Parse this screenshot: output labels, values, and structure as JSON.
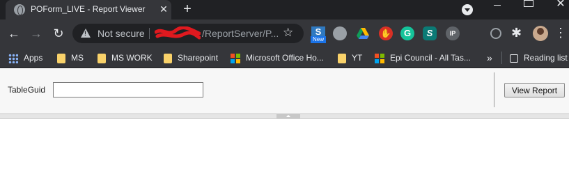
{
  "browser": {
    "tab": {
      "title": "POForm_LIVE - Report Viewer",
      "favicon": "globe-icon",
      "close_icon": "close-icon"
    },
    "new_tab_icon": "plus-icon",
    "window_controls": {
      "minimize": "minimize-icon",
      "maximize": "maximize-icon",
      "close": "close-icon"
    },
    "nav": {
      "back": "back-arrow-icon",
      "forward": "forward-arrow-icon",
      "reload": "reload-icon"
    },
    "omnibox": {
      "security_text": "Not secure",
      "url_visible": "/ReportServer/P...",
      "bookmark_icon": "star-icon"
    },
    "extensions": {
      "s_label": "S",
      "s_badge": "New",
      "g_label": "G",
      "f_label": "S",
      "ip_label": "IP"
    },
    "bookmarks": [
      {
        "label": "Apps",
        "icon": "apps-grid-icon"
      },
      {
        "label": "MS",
        "icon": "folder-icon"
      },
      {
        "label": "MS WORK",
        "icon": "folder-icon"
      },
      {
        "label": "Sharepoint",
        "icon": "folder-icon"
      },
      {
        "label": "Microsoft Office Ho...",
        "icon": "microsoft-logo-icon"
      },
      {
        "label": "YT",
        "icon": "folder-icon"
      },
      {
        "label": "Epi Council - All Tas...",
        "icon": "microsoft-logo-icon"
      }
    ],
    "bookmarks_more": "»",
    "reading_list": "Reading list"
  },
  "report": {
    "param_label": "TableGuid",
    "param_value": "",
    "view_button": "View Report"
  },
  "colors": {
    "titlebar": "#202124",
    "toolbar": "#35363a",
    "param_bg": "#f7f7f7"
  }
}
